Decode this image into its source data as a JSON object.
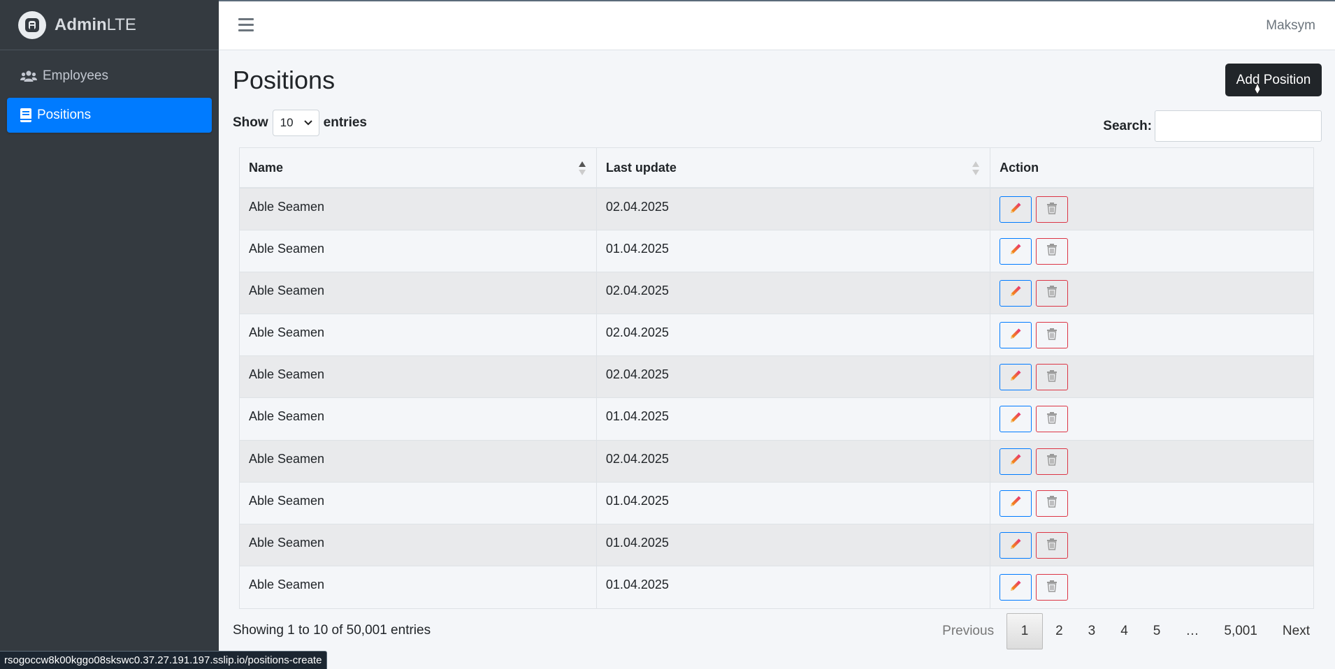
{
  "brand": {
    "name_bold": "Admin",
    "name_light": "LTE"
  },
  "sidebar": {
    "items": [
      {
        "label": "Employees",
        "icon": "users-icon",
        "active": false
      },
      {
        "label": "Positions",
        "icon": "book-icon",
        "active": true
      }
    ]
  },
  "topbar": {
    "user": "Maksym"
  },
  "page": {
    "title": "Positions",
    "add_label": "Add Position"
  },
  "controls": {
    "show_label": "Show",
    "show_value": "10",
    "entries_label": "entries",
    "search_label": "Search:",
    "search_value": ""
  },
  "table": {
    "headers": [
      "Name",
      "Last update",
      "Action"
    ],
    "rows": [
      {
        "name": "Able Seamen",
        "updated": "02.04.2025"
      },
      {
        "name": "Able Seamen",
        "updated": "01.04.2025"
      },
      {
        "name": "Able Seamen",
        "updated": "02.04.2025"
      },
      {
        "name": "Able Seamen",
        "updated": "02.04.2025"
      },
      {
        "name": "Able Seamen",
        "updated": "02.04.2025"
      },
      {
        "name": "Able Seamen",
        "updated": "01.04.2025"
      },
      {
        "name": "Able Seamen",
        "updated": "02.04.2025"
      },
      {
        "name": "Able Seamen",
        "updated": "01.04.2025"
      },
      {
        "name": "Able Seamen",
        "updated": "01.04.2025"
      },
      {
        "name": "Able Seamen",
        "updated": "01.04.2025"
      }
    ]
  },
  "footer": {
    "info": "Showing 1 to 10 of 50,001 entries",
    "pagination": {
      "previous": "Previous",
      "pages": [
        "1",
        "2",
        "3",
        "4",
        "5"
      ],
      "ellipsis": "…",
      "last": "5,001",
      "next": "Next",
      "current": "1"
    }
  },
  "status_bar": {
    "url": "rsogoccw8k00kggo08skswc0.37.27.191.197.sslip.io/positions-create"
  },
  "colors": {
    "primary": "#007bff",
    "danger": "#dc3545",
    "sidebar": "#343a40",
    "dark_button": "#212529"
  }
}
